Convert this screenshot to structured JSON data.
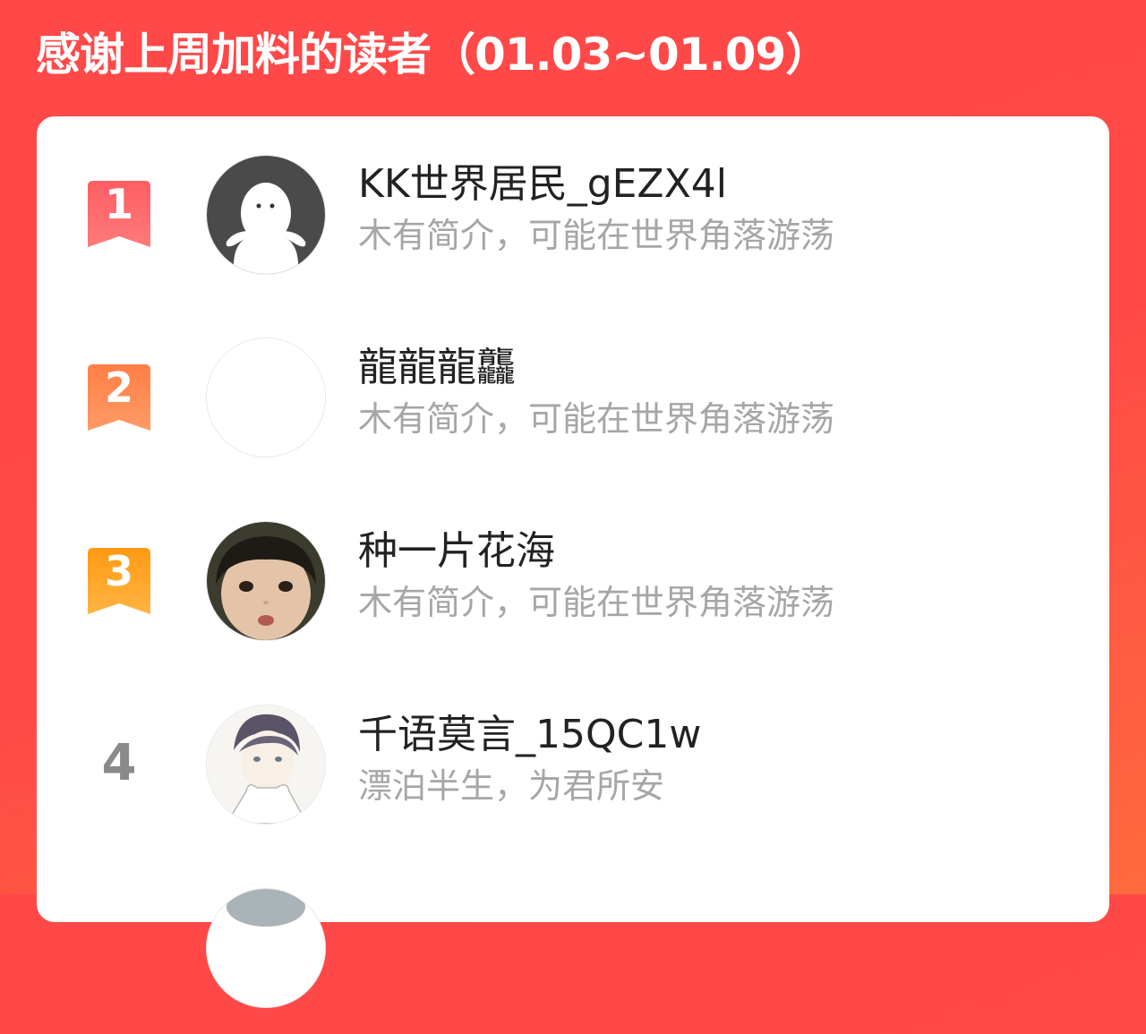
{
  "header": {
    "title": "感谢上周加料的读者（01.03~01.09）"
  },
  "colors": {
    "background_top": "#ff4848",
    "background_bottom": "#ff6a3d",
    "rank1": "#ff5a5f",
    "rank2": "#ff8a4a",
    "rank3": "#ffa21c",
    "rank_plain": "#8a8a8a"
  },
  "readers": [
    {
      "rank": "1",
      "name": "KK世界居民_gEZX4l",
      "bio": "木有简介，可能在世界角落游荡",
      "avatar": "default-character-avatar"
    },
    {
      "rank": "2",
      "name": "龍龍龍龘",
      "bio": "木有简介，可能在世界角落游荡",
      "avatar": "blank-avatar"
    },
    {
      "rank": "3",
      "name": "种一片花海",
      "bio": "木有简介，可能在世界角落游荡",
      "avatar": "child-photo-avatar"
    },
    {
      "rank": "4",
      "name": "千语莫言_15QC1w",
      "bio": "漂泊半生，为君所安",
      "avatar": "anime-boy-avatar"
    },
    {
      "rank": "",
      "name": "",
      "bio": "",
      "avatar": "partial-avatar"
    }
  ]
}
